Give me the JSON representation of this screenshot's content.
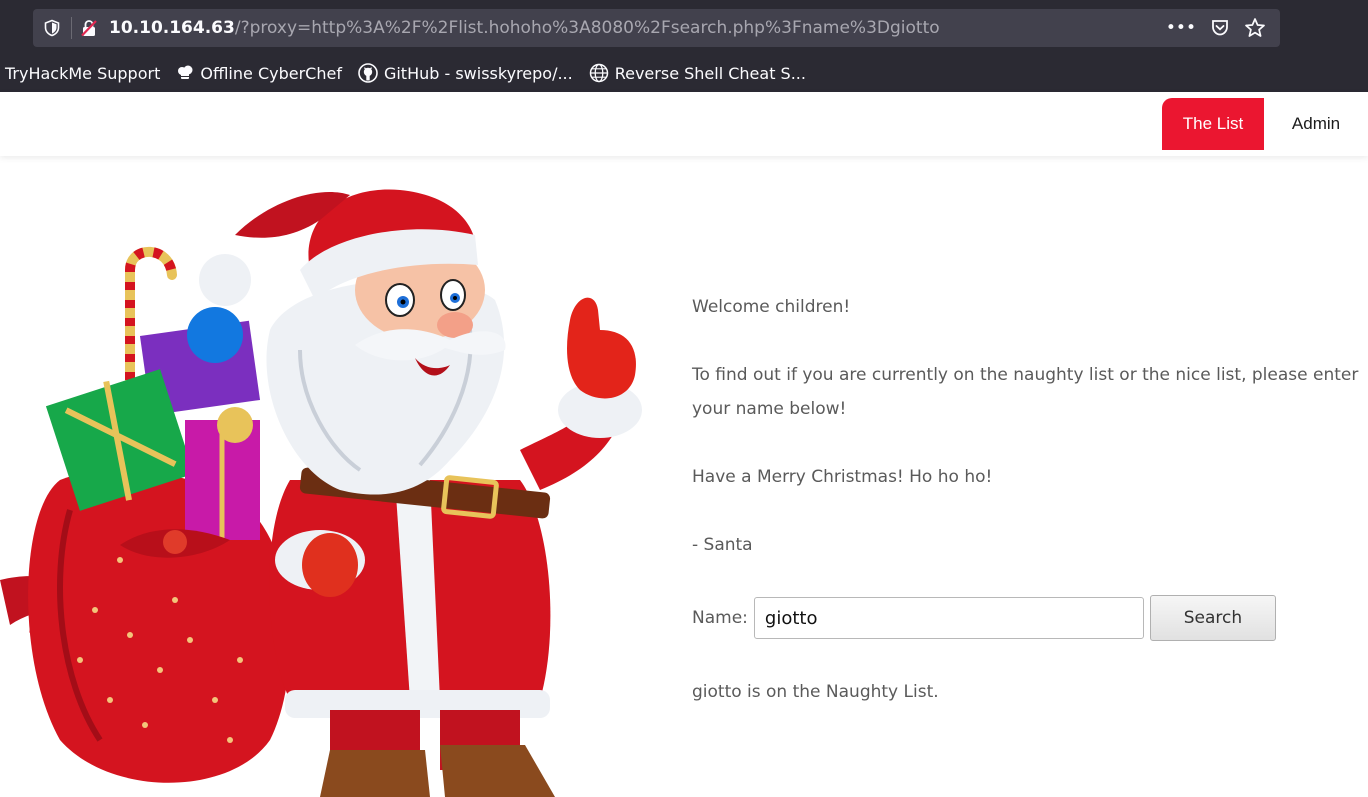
{
  "browser": {
    "url_host": "10.10.164.63",
    "url_rest": "/?proxy=http%3A%2F%2Flist.hohoho%3A8080%2Fsearch.php%3Fname%3Dgiotto",
    "more_label": "•••",
    "bookmarks": [
      {
        "label": "TryHackMe Support",
        "icon": "none"
      },
      {
        "label": "Offline CyberChef",
        "icon": "chef-hat-icon"
      },
      {
        "label": "GitHub - swisskyrepo/...",
        "icon": "github-icon"
      },
      {
        "label": "Reverse Shell Cheat S...",
        "icon": "globe-icon"
      }
    ]
  },
  "nav": {
    "items": [
      {
        "label": "The List",
        "active": true
      },
      {
        "label": "Admin",
        "active": false
      }
    ]
  },
  "content": {
    "greeting": "Welcome children!",
    "instructions": "To find out if you are currently on the naughty list or the nice list, please enter your name below!",
    "wish": "Have a Merry Christmas! Ho ho ho!",
    "signature": "- Santa",
    "form": {
      "label": "Name:",
      "value": "giotto",
      "button": "Search"
    },
    "result": "giotto is on the Naughty List."
  },
  "colors": {
    "accent": "#eb1630",
    "chrome_bg": "#2b2a33",
    "urlbar_bg": "#42414d",
    "body_text": "#5a5a5a"
  }
}
